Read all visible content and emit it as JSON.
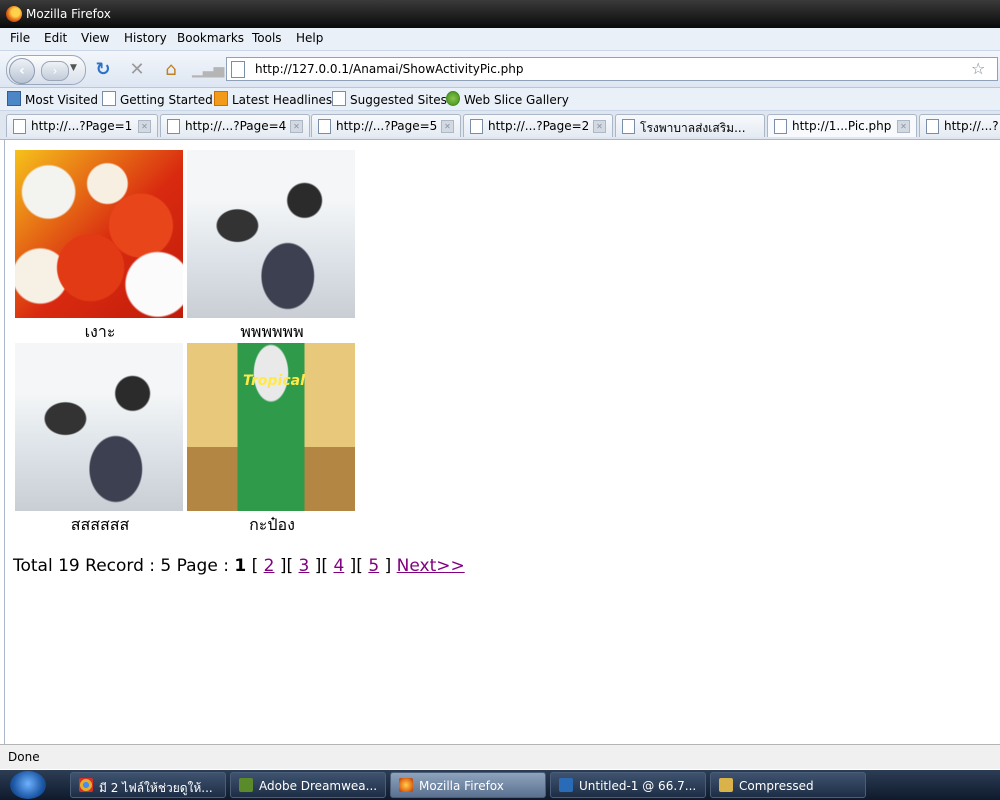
{
  "window": {
    "title": "Mozilla Firefox"
  },
  "menu": [
    "File",
    "Edit",
    "View",
    "History",
    "Bookmarks",
    "Tools",
    "Help"
  ],
  "address": {
    "url": "http://127.0.0.1/Anamai/ShowActivityPic.php"
  },
  "bookmarks": [
    {
      "label": "Most Visited",
      "icon": "folder-icon"
    },
    {
      "label": "Getting Started",
      "icon": "page-icon"
    },
    {
      "label": "Latest Headlines",
      "icon": "rss-icon"
    },
    {
      "label": "Suggested Sites",
      "icon": "page-icon"
    },
    {
      "label": "Web Slice Gallery",
      "icon": "web-slice-icon"
    }
  ],
  "tabs": [
    {
      "label": "http://...?Page=1"
    },
    {
      "label": "http://...?Page=4"
    },
    {
      "label": "http://...?Page=5"
    },
    {
      "label": "http://...?Page=2"
    },
    {
      "label": "โรงพาบาลส่งเสริม..."
    },
    {
      "label": "http://1...Pic.php"
    },
    {
      "label": "http://...?"
    }
  ],
  "gallery": [
    {
      "caption": "เงาะ",
      "image": "fruit-photo"
    },
    {
      "caption": "พพพพพพ",
      "image": "meeting-photo"
    },
    {
      "caption": "สสสสสส",
      "image": "meeting-photo"
    },
    {
      "caption": "กะป๋อง",
      "image": "can-photo",
      "can_text": "Tropical"
    }
  ],
  "pager": {
    "summary": "Total 19 Record : 5 Page :",
    "current": "1",
    "pages": [
      "2",
      "3",
      "4",
      "5"
    ],
    "next": "Next>>"
  },
  "status": "Done",
  "taskbar": [
    {
      "label": "มี 2 ไฟล์ให้ช่วยดูให้...",
      "icon_color": "#e0b030"
    },
    {
      "label": "Adobe Dreamwea...",
      "icon_color": "#5a8a2a"
    },
    {
      "label": "Mozilla Firefox",
      "icon_color": "#e8731c"
    },
    {
      "label": "Untitled-1 @ 66.7...",
      "icon_color": "#2a6bb8"
    },
    {
      "label": "Compressed",
      "icon_color": "#d9b24a"
    }
  ]
}
